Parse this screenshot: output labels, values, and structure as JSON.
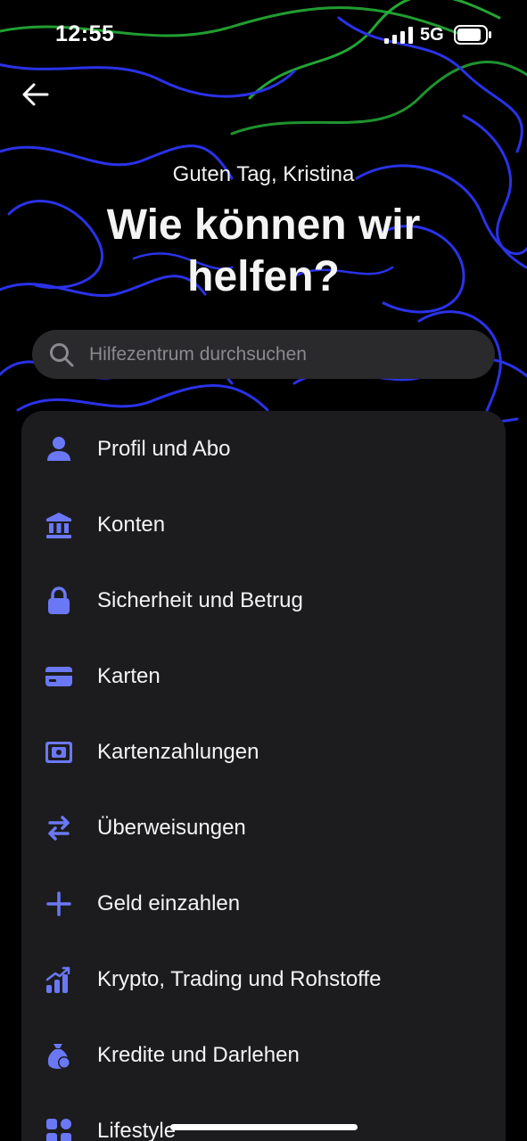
{
  "status_bar": {
    "time": "12:55",
    "network": "5G",
    "icons": [
      "signal-icon",
      "battery-icon"
    ]
  },
  "header": {
    "back_icon": "arrow-left-icon",
    "greeting": "Guten Tag, Kristina",
    "title": "Wie können wir helfen?"
  },
  "search": {
    "placeholder": "Hilfezentrum durchsuchen",
    "icon": "search-icon"
  },
  "menu": {
    "items": [
      {
        "label": "Profil und Abo",
        "icon": "person-icon"
      },
      {
        "label": "Konten",
        "icon": "bank-icon"
      },
      {
        "label": "Sicherheit und Betrug",
        "icon": "lock-icon"
      },
      {
        "label": "Karten",
        "icon": "credit-card-icon"
      },
      {
        "label": "Kartenzahlungen",
        "icon": "card-payment-icon"
      },
      {
        "label": "Überweisungen",
        "icon": "transfer-arrows-icon"
      },
      {
        "label": "Geld einzahlen",
        "icon": "plus-icon"
      },
      {
        "label": "Krypto, Trading und Rohstoffe",
        "icon": "trading-chart-icon"
      },
      {
        "label": "Kredite und Darlehen",
        "icon": "money-bag-icon"
      },
      {
        "label": "Lifestyle",
        "icon": "grid-icon"
      }
    ]
  },
  "colors": {
    "accent": "#6b78f5",
    "background": "#000000",
    "card": "#1c1c1e",
    "search_bg": "#2a2a2c",
    "placeholder": "#8a8a8f",
    "wave_blue": "#2a32e8",
    "wave_green": "#27b83a"
  }
}
